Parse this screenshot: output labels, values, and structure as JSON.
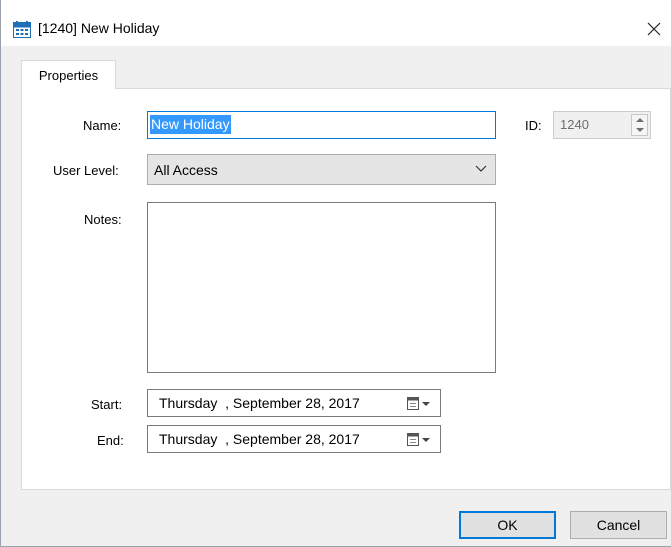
{
  "window": {
    "title": "[1240] New Holiday"
  },
  "tabs": [
    {
      "label": "Properties"
    }
  ],
  "form": {
    "name_label": "Name:",
    "name_value": "New Holiday",
    "id_label": "ID:",
    "id_value": "1240",
    "user_level_label": "User Level:",
    "user_level_value": "All Access",
    "notes_label": "Notes:",
    "notes_value": "",
    "start_label": "Start:",
    "start_value": "Thursday  , September 28, 2017",
    "end_label": "End:",
    "end_value": "Thursday  , September 28, 2017"
  },
  "buttons": {
    "ok": "OK",
    "cancel": "Cancel"
  },
  "icons": {
    "title": "calendar-icon",
    "close": "close-icon",
    "dropdown": "chevron-down-icon",
    "spinner": "spinner-arrows-icon",
    "date_picker": "calendar-dropdown-icon"
  },
  "colors": {
    "accent": "#0078d7",
    "selection": "#3399ff",
    "dialog_bg": "#f0f0f0"
  }
}
